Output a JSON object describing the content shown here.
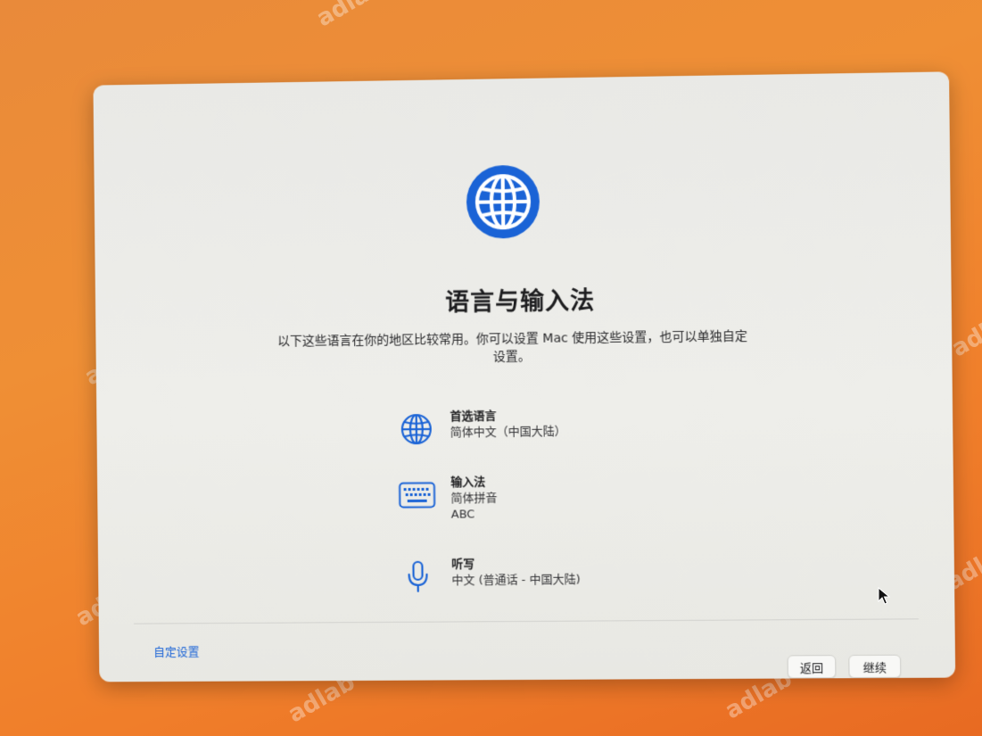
{
  "window": {
    "title": "语言与输入法",
    "description": "以下这些语言在你的地区比较常用。你可以设置 Mac 使用这些设置，也可以单独自定设置。"
  },
  "settings": {
    "language": {
      "label": "首选语言",
      "value": "简体中文（中国大陆）",
      "icon": "globe-icon"
    },
    "input": {
      "label": "输入法",
      "values": [
        "简体拼音",
        "ABC"
      ],
      "icon": "keyboard-icon"
    },
    "dictation": {
      "label": "听写",
      "value": "中文 (普通话 - 中国大陆)",
      "icon": "microphone-icon"
    }
  },
  "footer": {
    "custom_link": "自定设置",
    "back_label": "返回",
    "continue_label": "继续"
  },
  "watermark": "adlab",
  "colors": {
    "accent": "#1a63d6",
    "background": "#ef8f35"
  }
}
